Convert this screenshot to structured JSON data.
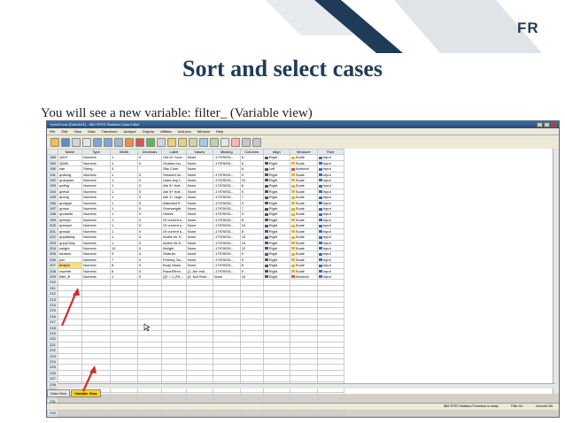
{
  "header": {
    "brand": "FR",
    "title": "Sort and select cases",
    "subtitle": "You will see a new variable: filter_ (Variable view)"
  },
  "window": {
    "title": "*yrbs09.sav [DataSet1] - IBM SPSS Statistics Data Editor",
    "menu": [
      "File",
      "Edit",
      "View",
      "Data",
      "Transform",
      "Analyze",
      "Graphs",
      "Utilities",
      "Add-ons",
      "Window",
      "Help"
    ],
    "columns": [
      "",
      "Name",
      "Type",
      "Width",
      "Decimals",
      "Label",
      "Values",
      "Missing",
      "Columns",
      "Align",
      "Measure",
      "Role"
    ],
    "rows": [
      [
        "188",
        "Q007",
        "Numeric",
        "1",
        "0",
        "Get 8+ hour...",
        "None",
        "-17976931...",
        "6",
        "Right",
        "Scale",
        "Input"
      ],
      [
        "189",
        "Q088",
        "Numeric",
        "1",
        "0",
        "Grades mo...",
        "None",
        "-17976931...",
        "6",
        "Right",
        "Scale",
        "Input"
      ],
      [
        "190",
        "site",
        "String",
        "3",
        "",
        "Site Code",
        "None",
        "",
        "6",
        "Left",
        "Nominal",
        "Input"
      ],
      [
        "191",
        "qn8crig",
        "Numeric",
        "1",
        "0",
        "Smoked on...",
        "None",
        "-17976931...",
        "9",
        "Right",
        "Scale",
        "Input"
      ],
      [
        "192",
        "qnanytob",
        "Numeric",
        "1",
        "0",
        "Used any t...",
        "None",
        "-17976931...",
        "10",
        "Right",
        "Scale",
        "Input"
      ],
      [
        "193",
        "qn8ng",
        "Numeric",
        "1",
        "0",
        "Ate 5+ fruit...",
        "None",
        "-17976931...",
        "8",
        "Right",
        "Scale",
        "Input"
      ],
      [
        "194",
        "qnfruit",
        "Numeric",
        "1",
        "0",
        "Ate 5+ fruit...",
        "None",
        "-17976931...",
        "9",
        "Right",
        "Scale",
        "Input"
      ],
      [
        "195",
        "qnveg",
        "Numeric",
        "1",
        "0",
        "Ate 2+ vege...",
        "None",
        "-17976931...",
        "7",
        "Right",
        "Scale",
        "Input"
      ],
      [
        "196",
        "qndfype",
        "Numeric",
        "1",
        "0",
        "Attended P...",
        "None",
        "-17976931...",
        "9",
        "Right",
        "Scale",
        "Input"
      ],
      [
        "197",
        "qnowt",
        "Numeric",
        "1",
        "0",
        "Overweight",
        "None",
        "-17976931...",
        "7",
        "Right",
        "Scale",
        "Input"
      ],
      [
        "198",
        "qnobese",
        "Numeric",
        "1",
        "0",
        "Obese",
        "None",
        "-17976931...",
        "9",
        "Right",
        "Scale",
        "Input"
      ],
      [
        "199",
        "qnbepc",
        "Numeric",
        "1",
        "0",
        "Of current s...",
        "None",
        "-17976931...",
        "8",
        "Right",
        "Scale",
        "Input"
      ],
      [
        "200",
        "qnbepcl",
        "Numeric",
        "1",
        "0",
        "Of current s...",
        "None",
        "-17976931...",
        "10",
        "Right",
        "Scale",
        "Input"
      ],
      [
        "201",
        "qndual",
        "Numeric",
        "1",
        "0",
        "Of current s...",
        "None",
        "-17976931...",
        "8",
        "Right",
        "Scale",
        "Input"
      ],
      [
        "202",
        "qnpa5day",
        "Numeric",
        "1",
        "0",
        "Active for 5...",
        "None",
        "-17976931...",
        "10",
        "Right",
        "Scale",
        "Input"
      ],
      [
        "203",
        "qnpa7day",
        "Numeric",
        "1",
        "0",
        "Active for 6...",
        "None",
        "-17976931...",
        "10",
        "Right",
        "Scale",
        "Input"
      ],
      [
        "204",
        "weight",
        "Numeric",
        "10",
        "0",
        "Weight",
        "None",
        "-17976931...",
        "12",
        "Right",
        "Scale",
        "Input"
      ],
      [
        "205",
        "stratum",
        "Numeric",
        "3",
        "0",
        "Stratum",
        "None",
        "-17976931...",
        "9",
        "Right",
        "Scale",
        "Input"
      ],
      [
        "206",
        "psu",
        "Numeric",
        "7",
        "0",
        "Primary Sa...",
        "None",
        "-17976931...",
        "9",
        "Right",
        "Scale",
        "Input"
      ],
      [
        "207",
        "bmipct",
        "Numeric",
        "8",
        "0",
        "Body Mass...",
        "None",
        "-17976931...",
        "8",
        "Right",
        "Scale",
        "Input"
      ],
      [
        "208",
        "raceeth",
        "Numeric",
        "8",
        "0",
        "Race/Ethni...",
        "{1, Am Indi...",
        "-17976931...",
        "9",
        "Right",
        "Scale",
        "Input"
      ],
      [
        "209",
        "filter_$",
        "Numeric",
        "1",
        "0",
        "Q2 = 1 (FIL...",
        "{0, Not Sele...",
        "None",
        "10",
        "Right",
        "Nominal",
        "Input"
      ]
    ],
    "empty_rows": [
      "210",
      "211",
      "212",
      "213",
      "214",
      "215",
      "216",
      "217",
      "218",
      "219",
      "220",
      "221",
      "222",
      "223",
      "224",
      "225",
      "226",
      "227",
      "228",
      "229",
      "230",
      "231",
      "232",
      "233",
      "234"
    ],
    "tabs": [
      "Data View",
      "Variable View"
    ],
    "status": {
      "processor": "IBM SPSS Statistics Processor is ready",
      "filter": "Filter On",
      "unicode": "Unicode:ON"
    }
  },
  "colors": {
    "title": "#1f3b57",
    "highlight": "#ffe066",
    "active_tab": "#ffd21f",
    "arrow": "#d22a2a"
  }
}
